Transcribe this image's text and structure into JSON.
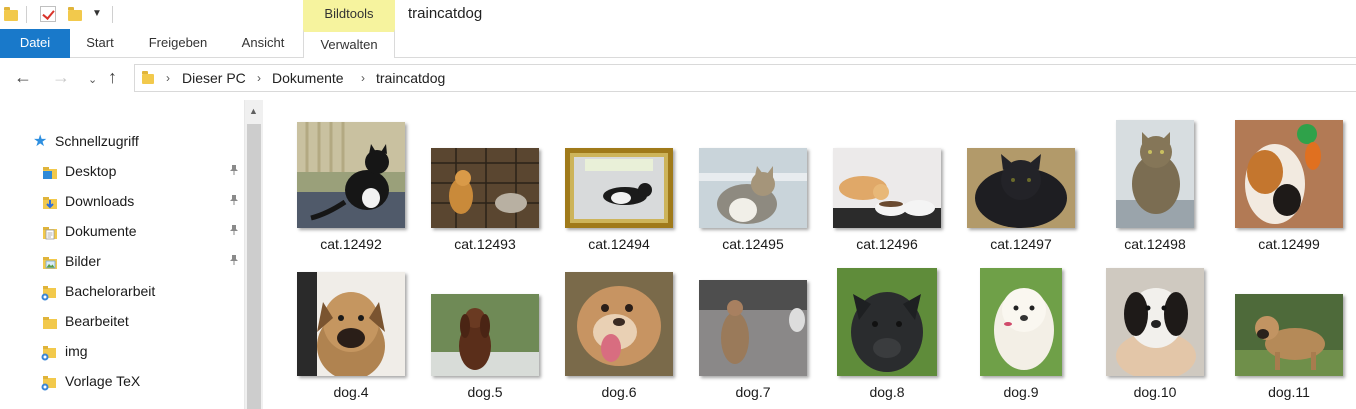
{
  "window": {
    "title": "traincatdog",
    "context_tab_header": "Bildtools"
  },
  "ribbon": {
    "tabs": [
      {
        "label": "Datei",
        "active": true
      },
      {
        "label": "Start"
      },
      {
        "label": "Freigeben"
      },
      {
        "label": "Ansicht"
      },
      {
        "label": "Verwalten"
      }
    ]
  },
  "navigation": {
    "back_icon": "←",
    "forward_icon": "→",
    "recent_icon": "⌄",
    "up_icon": "↑",
    "breadcrumb": [
      "Dieser PC",
      "Dokumente",
      "traincatdog"
    ],
    "separator": "›"
  },
  "sidebar": {
    "quick_access": {
      "label": "Schnellzugriff",
      "icon": "star-icon"
    },
    "items": [
      {
        "label": "Desktop",
        "icon": "desktop-folder-icon",
        "pinned": true
      },
      {
        "label": "Downloads",
        "icon": "downloads-folder-icon",
        "pinned": true
      },
      {
        "label": "Dokumente",
        "icon": "documents-folder-icon",
        "pinned": true
      },
      {
        "label": "Bilder",
        "icon": "pictures-folder-icon",
        "pinned": true
      },
      {
        "label": "Bachelorarbeit",
        "icon": "network-folder-icon",
        "pinned": false
      },
      {
        "label": "Bearbeitet",
        "icon": "folder-icon",
        "pinned": false
      },
      {
        "label": "img",
        "icon": "network-folder-icon",
        "pinned": false
      },
      {
        "label": "Vorlage TeX",
        "icon": "network-folder-icon",
        "pinned": false
      }
    ],
    "pin_glyph": "📌"
  },
  "files": {
    "row1": [
      {
        "name": "cat.12492"
      },
      {
        "name": "cat.12493"
      },
      {
        "name": "cat.12494"
      },
      {
        "name": "cat.12495"
      },
      {
        "name": "cat.12496"
      },
      {
        "name": "cat.12497"
      },
      {
        "name": "cat.12498"
      },
      {
        "name": "cat.12499"
      }
    ],
    "row2": [
      {
        "name": "dog.4"
      },
      {
        "name": "dog.5"
      },
      {
        "name": "dog.6"
      },
      {
        "name": "dog.7"
      },
      {
        "name": "dog.8"
      },
      {
        "name": "dog.9"
      },
      {
        "name": "dog.10"
      },
      {
        "name": "dog.11"
      }
    ]
  },
  "colors": {
    "datei_tab": "#1979ca",
    "context_tab": "#f6f39e",
    "folder": "#f2c94c",
    "star": "#2e8fe0"
  }
}
